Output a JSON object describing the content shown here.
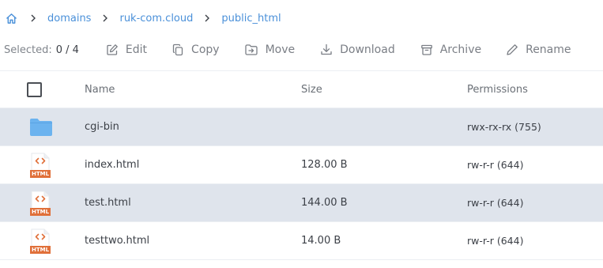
{
  "breadcrumb": {
    "items": [
      "domains",
      "ruk-com.cloud",
      "public_html"
    ]
  },
  "toolbar": {
    "selected_label": "Selected:",
    "selected_count": "0 / 4",
    "edit": "Edit",
    "copy": "Copy",
    "move": "Move",
    "download": "Download",
    "archive": "Archive",
    "rename": "Rename"
  },
  "table": {
    "columns": {
      "name": "Name",
      "size": "Size",
      "permissions": "Permissions"
    },
    "rows": [
      {
        "icon": "folder-icon",
        "name": "cgi-bin",
        "size": "",
        "permissions": "rwx-rx-rx (755)"
      },
      {
        "icon": "html-file-icon",
        "badge": "HTML",
        "name": "index.html",
        "size": "128.00 B",
        "permissions": "rw-r-r (644)"
      },
      {
        "icon": "html-file-icon",
        "badge": "HTML",
        "name": "test.html",
        "size": "144.00 B",
        "permissions": "rw-r-r (644)"
      },
      {
        "icon": "html-file-icon",
        "badge": "HTML",
        "name": "testtwo.html",
        "size": "14.00 B",
        "permissions": "rw-r-r (644)"
      }
    ]
  },
  "colors": {
    "accent": "#4a90d9",
    "row_shaded": "#dfe4ec",
    "folder": "#6cb3ef",
    "html_badge": "#e0703a"
  }
}
